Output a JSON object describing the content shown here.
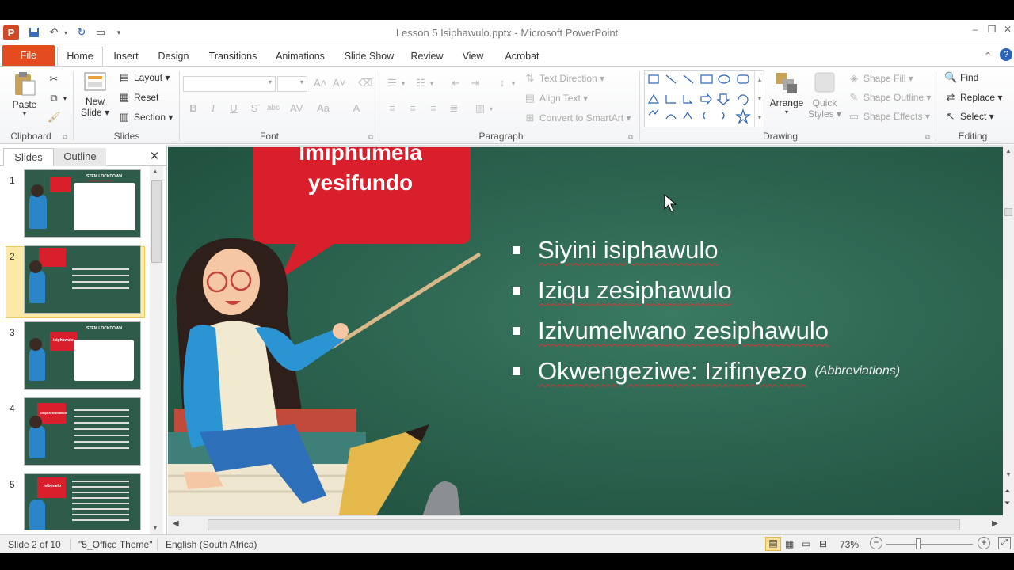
{
  "window": {
    "title": "Lesson 5 Isiphawulo.pptx  -  Microsoft PowerPoint",
    "app_icon": "P"
  },
  "tabs": [
    "File",
    "Home",
    "Insert",
    "Design",
    "Transitions",
    "Animations",
    "Slide Show",
    "Review",
    "View",
    "Acrobat"
  ],
  "ribbon": {
    "clipboard": {
      "label": "Clipboard",
      "paste": "Paste"
    },
    "slides": {
      "label": "Slides",
      "new_slide_1": "New",
      "new_slide_2": "Slide ▾",
      "layout": "Layout ▾",
      "reset": "Reset",
      "section": "Section ▾"
    },
    "font": {
      "label": "Font"
    },
    "paragraph": {
      "label": "Paragraph",
      "text_direction": "Text Direction ▾",
      "align_text": "Align Text ▾",
      "convert": "Convert to SmartArt ▾"
    },
    "drawing": {
      "label": "Drawing",
      "arrange": "Arrange",
      "quick_styles_1": "Quick",
      "quick_styles_2": "Styles ▾",
      "shape_fill": "Shape Fill ▾",
      "shape_outline": "Shape Outline ▾",
      "shape_effects": "Shape Effects ▾"
    },
    "editing": {
      "label": "Editing",
      "find": "Find",
      "replace": "Replace ▾",
      "select": "Select ▾"
    }
  },
  "panel": {
    "tab_slides": "Slides",
    "tab_outline": "Outline",
    "slide_numbers": [
      "1",
      "2",
      "3",
      "4",
      "5"
    ],
    "selected": 2
  },
  "slide": {
    "heading_line1": "Imiphumela",
    "heading_line2": "yesifundo",
    "bullets": [
      "Siyini isiphawulo",
      "Iziqu zesiphawulo",
      "Izivumelwano zesiphawulo",
      "Okwengeziwe: Izifinyezo"
    ],
    "abbreviation_note": "(Abbreviations)"
  },
  "thumbs": {
    "stem": "STEM LOCKDOWN",
    "digital": "DIGITAL SCHOOL",
    "t3_label": "Isiphawulo",
    "t4_label": "Iziqu zesiphawulo",
    "t5_label": "Isibonelo"
  },
  "status": {
    "slide": "Slide 2 of 10",
    "theme": "\"5_Office Theme\"",
    "language": "English (South Africa)",
    "zoom": "73%"
  },
  "colors": {
    "file_tab": "#e44c20",
    "chalkboard": "#2c6450",
    "bubble": "#d91f2b",
    "selected_thumb": "#fbe9a8"
  }
}
